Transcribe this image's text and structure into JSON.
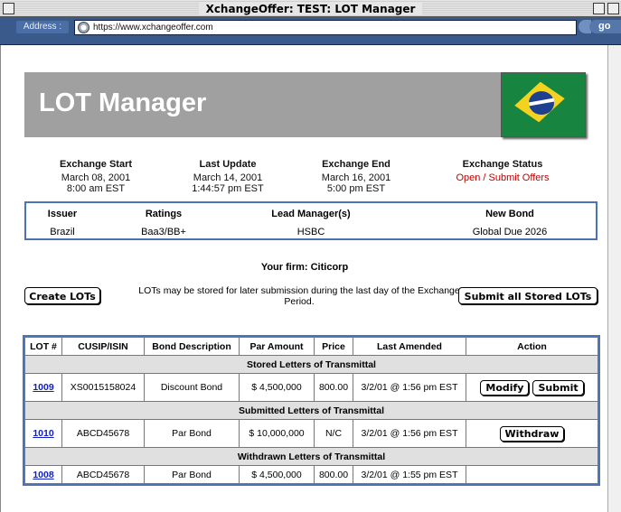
{
  "window": {
    "title": "XchangeOffer: TEST: LOT Manager"
  },
  "address": {
    "label": "Address :",
    "url": "https://www.xchangeoffer.com",
    "go": "go"
  },
  "banner": {
    "title": "LOT Manager"
  },
  "exchange": [
    {
      "label": "Exchange Start",
      "line1": "March 08, 2001",
      "line2": "8:00 am EST"
    },
    {
      "label": "Last Update",
      "line1": "March 14, 2001",
      "line2": "1:44:57 pm EST"
    },
    {
      "label": "Exchange End",
      "line1": "March 16, 2001",
      "line2": "5:00 pm EST"
    },
    {
      "label": "Exchange Status",
      "line1": "Open / Submit Offers",
      "line2": ""
    }
  ],
  "info": {
    "headers": [
      "Issuer",
      "Ratings",
      "Lead Manager(s)",
      "New Bond"
    ],
    "values": [
      "Brazil",
      "Baa3/BB+",
      "HSBC",
      "Global Due 2026"
    ]
  },
  "firm": "Your firm: Citicorp",
  "actions": {
    "create": "Create LOTs",
    "note": "LOTs may be stored for later submission during the last day of the Exchange Period.",
    "submit_all": "Submit all Stored LOTs"
  },
  "table": {
    "headers": [
      "LOT #",
      "CUSIP/ISIN",
      "Bond Description",
      "Par Amount",
      "Price",
      "Last Amended",
      "Action"
    ],
    "sections": [
      {
        "title": "Stored Letters of Transmittal",
        "rows": [
          {
            "lot": "1009",
            "cusip": "XS0015158024",
            "desc": "Discount Bond",
            "par": "$ 4,500,000",
            "price": "800.00",
            "amended": "3/2/01 @ 1:56 pm EST",
            "actions": [
              "Modify",
              "Submit"
            ]
          }
        ]
      },
      {
        "title": "Submitted Letters of Transmittal",
        "rows": [
          {
            "lot": "1010",
            "cusip": "ABCD45678",
            "desc": "Par Bond",
            "par": "$ 10,000,000",
            "price": "N/C",
            "amended": "3/2/01 @ 1:56 pm EST",
            "actions": [
              "Withdraw"
            ]
          }
        ]
      },
      {
        "title": "Withdrawn Letters of Transmittal",
        "rows": [
          {
            "lot": "1008",
            "cusip": "ABCD45678",
            "desc": "Par Bond",
            "par": "$ 4,500,000",
            "price": "800.00",
            "amended": "3/2/01 @ 1:55 pm EST",
            "actions": []
          }
        ]
      }
    ]
  }
}
